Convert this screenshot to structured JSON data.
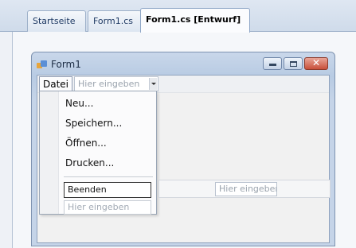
{
  "tabs": [
    {
      "label": "Startseite"
    },
    {
      "label": "Form1.cs"
    },
    {
      "label": "Form1.cs [Entwurf]"
    }
  ],
  "form": {
    "title": "Form1",
    "close_glyph": "✕"
  },
  "menubar": {
    "datei": "Datei",
    "type_here": "Hier eingeben"
  },
  "menu": {
    "items": [
      "Neu...",
      "Speichern...",
      "Öffnen...",
      "Drucken..."
    ],
    "editing_value": "Beenden",
    "type_here": "Hier eingeben"
  },
  "submenu": {
    "type_here": "Hier eingeben"
  }
}
